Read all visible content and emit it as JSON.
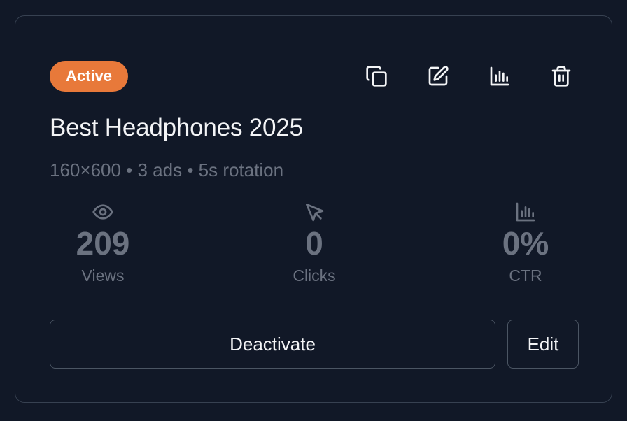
{
  "card": {
    "status": "Active",
    "title": "Best Headphones 2025",
    "meta": "160×600 • 3 ads • 5s rotation",
    "actions": [
      {
        "icon": "copy-icon",
        "label": "Duplicate"
      },
      {
        "icon": "edit-icon",
        "label": "Edit"
      },
      {
        "icon": "chart-icon",
        "label": "Analytics"
      },
      {
        "icon": "trash-icon",
        "label": "Delete"
      }
    ],
    "stats": [
      {
        "icon": "eye-icon",
        "value": "209",
        "label": "Views"
      },
      {
        "icon": "cursor-icon",
        "value": "0",
        "label": "Clicks"
      },
      {
        "icon": "chart-icon",
        "value": "0%",
        "label": "CTR"
      }
    ],
    "buttons": {
      "deactivate": "Deactivate",
      "edit": "Edit"
    }
  },
  "colors": {
    "background": "#111827",
    "border": "#374151",
    "badge": "#e8793a",
    "muted": "#6b7280",
    "text": "#f3f4f6"
  }
}
